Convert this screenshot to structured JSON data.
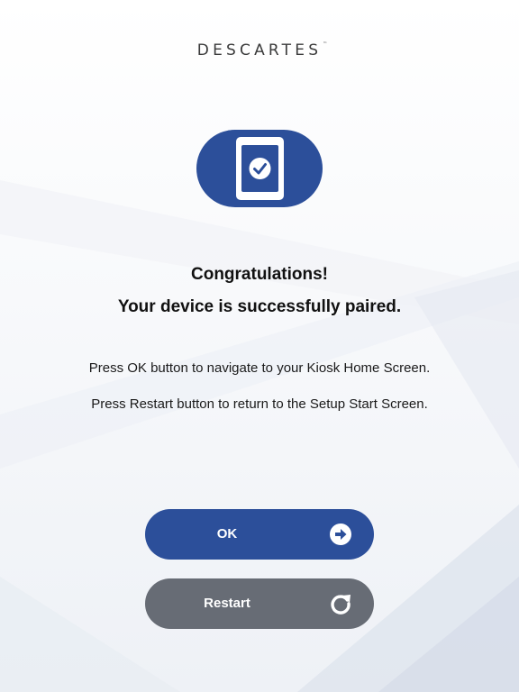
{
  "brand": {
    "logo_text": "DESCARTES",
    "trademark": "™",
    "accent_color": "#2c4f9a"
  },
  "status_icon": {
    "name": "device-paired-icon",
    "color": "#2c4f9a"
  },
  "message": {
    "heading": "Congratulations!",
    "subheading": "Your device is successfully paired.",
    "instruction_ok": "Press OK button to navigate to your Kiosk Home Screen.",
    "instruction_restart": "Press Restart button to return to the Setup Start Screen."
  },
  "buttons": {
    "ok": {
      "label": "OK",
      "icon": "arrow-right-circle-icon",
      "color": "#2c4f9a"
    },
    "restart": {
      "label": "Restart",
      "icon": "restart-icon",
      "color": "#676c75"
    }
  }
}
